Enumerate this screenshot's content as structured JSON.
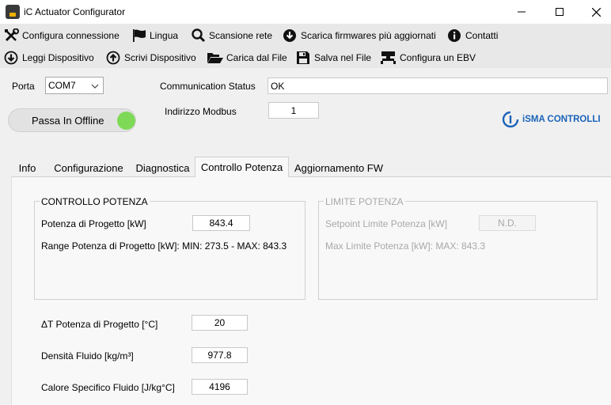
{
  "window": {
    "title": "iC Actuator Configurator"
  },
  "toolbar": {
    "row1": [
      {
        "label": "Configura connessione",
        "icon": "wrench-icon"
      },
      {
        "label": "Lingua",
        "icon": "flag-icon"
      },
      {
        "label": "Scansione rete",
        "icon": "magnifier-icon"
      },
      {
        "label": "Scarica firmwares più aggiornati",
        "icon": "download-circle-icon"
      },
      {
        "label": "Contatti",
        "icon": "info-icon"
      }
    ],
    "row2": [
      {
        "label": "Leggi Dispositivo",
        "icon": "arrow-down-circle-icon"
      },
      {
        "label": "Scrivi Dispositivo",
        "icon": "arrow-up-circle-icon"
      },
      {
        "label": "Carica dal File",
        "icon": "folder-open-icon"
      },
      {
        "label": "Salva nel File",
        "icon": "floppy-icon"
      },
      {
        "label": "Configura un EBV",
        "icon": "device-icon"
      }
    ]
  },
  "connection": {
    "port_label": "Porta",
    "port_value": "COM7",
    "status_label": "Communication Status",
    "status_value": "OK",
    "modbus_label": "Indirizzo Modbus",
    "modbus_value": "1",
    "offline_button": "Passa In Offline",
    "online_indicator_color": "#7ed957"
  },
  "brand": {
    "name": "iSMA CONTROLLI",
    "color": "#1a63b8"
  },
  "tabs": [
    {
      "label": "Info",
      "active": false
    },
    {
      "label": "Configurazione",
      "active": false
    },
    {
      "label": "Diagnostica",
      "active": false
    },
    {
      "label": "Controllo Potenza",
      "active": true
    },
    {
      "label": "Aggiornamento FW",
      "active": false
    }
  ],
  "controllo_potenza": {
    "title": "CONTROLLO POTENZA",
    "potenza_label": "Potenza di Progetto [kW]",
    "potenza_value": "843.4",
    "range_text": "Range Potenza di Progetto [kW]: MIN: 273.5 - MAX: 843.3"
  },
  "limite_potenza": {
    "title": "LIMITE POTENZA",
    "setpoint_label": "Setpoint Limite Potenza [kW]",
    "setpoint_value": "N.D.",
    "max_text": "Max Limite Potenza [kW]: MAX: 843.3"
  },
  "params": [
    {
      "label": "ΔT Potenza di Progetto [°C]",
      "value": "20"
    },
    {
      "label": "Densità Fluido [kg/m³]",
      "value": "977.8"
    },
    {
      "label": "Calore Specifico Fluido [J/kg°C]",
      "value": "4196"
    }
  ]
}
